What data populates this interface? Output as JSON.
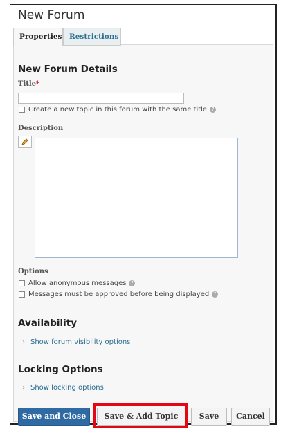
{
  "window": {
    "title": "New Forum"
  },
  "tabs": [
    {
      "label": "Properties"
    },
    {
      "label": "Restrictions"
    }
  ],
  "details": {
    "heading": "New Forum Details",
    "title_label": "Title",
    "required_mark": "*",
    "same_title_checkbox": "Create a new topic in this forum with the same title",
    "description_label": "Description"
  },
  "options": {
    "label": "Options",
    "anonymous": "Allow anonymous messages",
    "approval": "Messages must be approved before being displayed"
  },
  "availability": {
    "heading": "Availability",
    "link": "Show forum visibility options"
  },
  "locking": {
    "heading": "Locking Options",
    "link": "Show locking options"
  },
  "buttons": {
    "save_close": "Save and Close",
    "save_add_topic": "Save & Add Topic",
    "save": "Save",
    "cancel": "Cancel"
  },
  "colors": {
    "primary": "#2f6aa3",
    "link": "#2a6d8f",
    "highlight": "#e30613"
  }
}
